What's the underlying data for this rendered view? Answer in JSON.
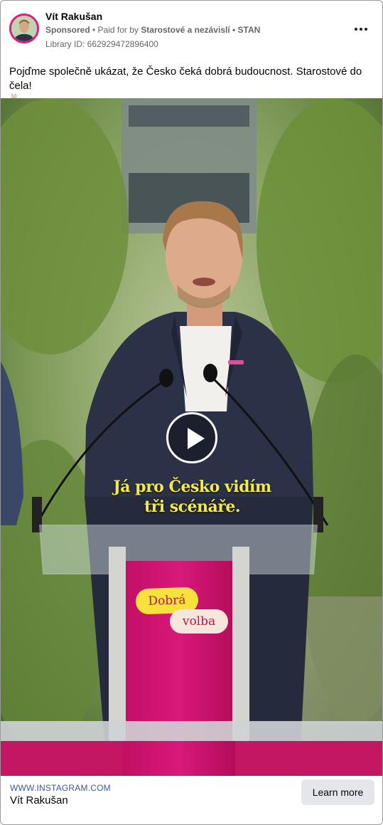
{
  "post": {
    "page_name": "Vít Rakušan",
    "sponsored": "Sponsored",
    "paid_prefix": "• Paid for by",
    "payer": "Starostové a nezávislí • STAN",
    "library_id": "Library ID: 662929472896400",
    "caption": "Pojďme společně ukázat, že Česko čeká dobrá budoucnost. Starostové do čela!",
    "caption_emoji": "victory-hand-emoji"
  },
  "video": {
    "subtitle_line1": "Já pro Česko vidím",
    "subtitle_line2": "tři scénáře.",
    "podium_bubble1": "Dobrá",
    "podium_bubble2": "volba",
    "play_icon": "play-icon"
  },
  "footer": {
    "domain": "WWW.INSTAGRAM.COM",
    "title": "Vít Rakušan",
    "cta_label": "Learn more"
  },
  "colors": {
    "accent": "#e0197d",
    "link": "#385898",
    "subtitle": "#f4e94a",
    "podium": "#d3136f"
  }
}
